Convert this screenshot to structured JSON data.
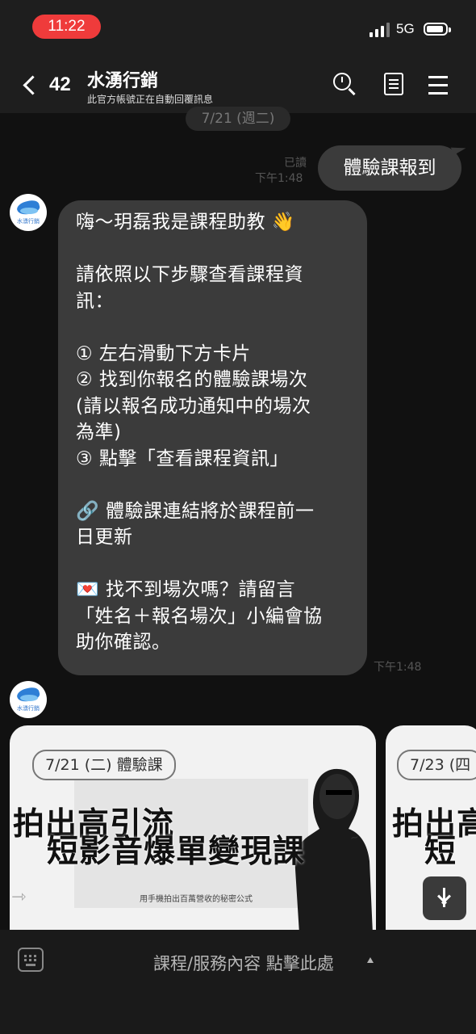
{
  "status_bar": {
    "time": "11:22",
    "network": "5G"
  },
  "header": {
    "back_count": "42",
    "title": "水湧行銷",
    "subtitle": "此官方帳號正在自動回覆訊息"
  },
  "chat": {
    "date_separator": "7/21 (週二)",
    "outgoing": {
      "text": "體驗課報到",
      "read_status": "已讀",
      "time": "下午1:48"
    },
    "incoming_text": {
      "time": "下午1:48",
      "lines": [
        "嗨～玥磊我是課程助教 👋",
        "",
        "請依照以下步驟查看課程資",
        "訊：",
        "",
        "① 左右滑動下方卡片",
        "② 找到你報名的體驗課場次",
        "(請以報名成功通知中的場次",
        "為準)",
        "③ 點擊「查看課程資訊」",
        "",
        "🔗 體驗課連結將於課程前一",
        "日更新",
        "",
        "💌 找不到場次嗎？請留言",
        "「姓名＋報名場次」小編會協",
        "助你確認。"
      ]
    },
    "carousel": {
      "cards": [
        {
          "tag": "7/21 (二) 體驗課",
          "headline_1": "拍出高引流",
          "headline_2": "短影音爆單變現課",
          "caption": "用手機拍出百萬營收的秘密公式"
        },
        {
          "tag": "7/23 (四",
          "headline_1": "拍出高",
          "headline_2": "短"
        }
      ]
    }
  },
  "avatar_text": "水湧行銷",
  "bottom_bar": {
    "rich_menu_label": "課程/服務內容 點擊此處"
  },
  "colors": {
    "time_pill": "#ef3b3b",
    "bubble": "#3b3b3b",
    "background": "#111111",
    "brand_blue": "#2e7fd6"
  }
}
